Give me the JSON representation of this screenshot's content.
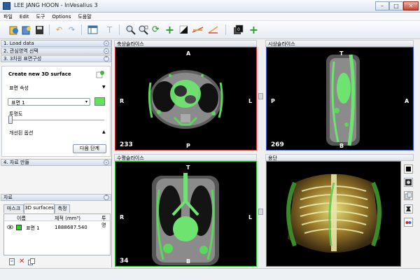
{
  "window": {
    "title": "LEE JANG HOON - InVesalius 3",
    "minimize": "–",
    "maximize": "□",
    "close": "✕"
  },
  "menu": [
    "파일",
    "Edit",
    "도구",
    "Options",
    "도움말"
  ],
  "left": {
    "sections": [
      "1. Load data",
      "2. 관심영역 선택",
      "3. 3차원 표면구성",
      "4. 자료 만들"
    ],
    "surface": {
      "header": "Create new 3D surface",
      "properties_label": "표면 속성",
      "surface_select": "표면 1",
      "surface_color": "#66e05a",
      "transparency_label": "투명도",
      "transparency": 0,
      "advanced_label": "개선된 옵션",
      "next_button": "다음 단계"
    },
    "data": {
      "header": "자료",
      "tabs": [
        "마스크",
        "3D surfaces",
        "측정"
      ],
      "active_tab": 1,
      "columns": [
        "이름",
        "체적 (mm³)",
        "투명"
      ],
      "rows": [
        {
          "name": "표면 1",
          "volume": "1888687.540",
          "color": "#33cc33"
        }
      ]
    }
  },
  "views": {
    "axial": {
      "title": "축상슬라이스",
      "top": "A",
      "bottom": "P",
      "left": "R",
      "right": "L",
      "slice": "233",
      "border": "#cc3333"
    },
    "sagittal": {
      "title": "시상슬라이스",
      "top": "T",
      "bottom": "B",
      "left": "P",
      "right": "A",
      "slice": "269",
      "border": "#3b5fd0"
    },
    "coronal": {
      "title": "수평슬라이스",
      "top": "T",
      "bottom": "B",
      "left": "R",
      "right": "L",
      "slice": "34",
      "border": "#33bb33"
    },
    "volume": {
      "title": "용단"
    }
  },
  "icons": {
    "toolbar": [
      "open-image-icon",
      "import-icon",
      "save-icon",
      "undo-icon",
      "redo-icon",
      "layout-icon",
      "text-icon",
      "zoom-in-icon",
      "zoom-out-icon",
      "rotate-icon",
      "move-icon",
      "contrast-icon",
      "measure-linear-icon",
      "measure-angle-icon",
      "slice-stack-icon",
      "add-icon"
    ],
    "volume_tools": [
      "background-color-icon",
      "render-preset-icon",
      "copy-view-icon",
      "orientation-icon",
      "stereo-icon"
    ]
  }
}
